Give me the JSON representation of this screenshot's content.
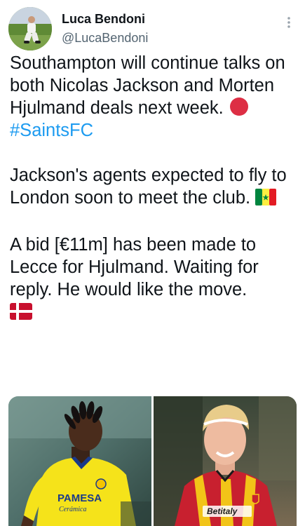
{
  "author": {
    "name": "Luca Bendoni",
    "handle": "@LucaBendoni"
  },
  "tweet": {
    "p1_text": "Southampton will continue talks on both Nicolas Jackson and Morten Hjulmand deals next week.",
    "p1_hashtag": "#SaintsFC",
    "p2_text": "Jackson's agents expected to fly to London soon to meet the club.",
    "p3_text": "A bid [€11m] has been made to Lecce for Hjulmand. Waiting for reply. He would like the move."
  },
  "media": {
    "left_photo_shirt_text": "PAMESA",
    "left_photo_shirt_subtext": "Cerámica",
    "right_photo_shirt_text": "Betitaly"
  },
  "icons": {
    "red_circle": "red-circle-emoji",
    "senegal_flag": "flag-senegal",
    "denmark_flag": "flag-denmark",
    "more": "more-vertical-icon"
  },
  "colors": {
    "hashtag": "#1d9bf0",
    "handle": "#536471",
    "text": "#0f1419",
    "villarreal_yellow": "#f5e31a",
    "lecce_red": "#c8202f",
    "lecce_yellow": "#f2c418"
  }
}
